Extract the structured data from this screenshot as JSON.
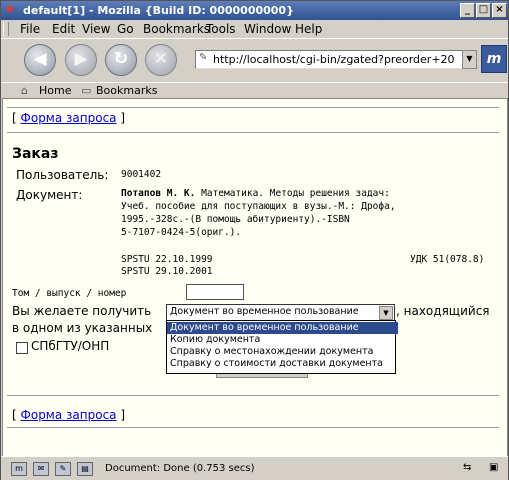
{
  "window": {
    "title": "default[1] - Mozilla {Build ID: 0000000000}",
    "app_icon": "mozilla-star-icon",
    "controls": {
      "minimize": "_",
      "maximize": "□",
      "close": "×"
    }
  },
  "menu": [
    "File",
    "Edit",
    "View",
    "Go",
    "Bookmarks",
    "Tools",
    "Window",
    "Help"
  ],
  "navbar": {
    "back_icon": "back-arrow-icon",
    "forward_icon": "forward-arrow-icon",
    "reload_icon": "reload-icon",
    "stop_icon": "stop-icon",
    "url": "http://localhost/cgi-bin/zgated?preorder+20",
    "logo": "m"
  },
  "personal_toolbar": {
    "home": "Home",
    "bookmarks": "Bookmarks"
  },
  "page": {
    "top_link": "Форма запроса",
    "bracket_open": "[",
    "bracket_close": "]",
    "heading": "Заказ",
    "user_label": "Пользователь:",
    "user_value": "9001402",
    "doc_label": "Документ:",
    "doc_author": "Потапов М. К.",
    "doc_line1_rest": "Математика. Методы решения задач:",
    "doc_line2": "Учеб. пособие для поступающих в вузы.-М.: Дрофа,",
    "doc_line3": "1995.-328с.-(В помощь абитуриенту).-ISBN",
    "doc_line4": "5-7107-0424-5(ориг.).",
    "loc1": "SPSTU 22.10.1999",
    "loc2": "SPSTU 29.10.2001",
    "udk": "УДК 51(078.8)",
    "volume_label": "Том / выпуск / номер",
    "want_label": "Вы желаете получить",
    "want_suffix": ", находящийся",
    "in_one_label": "в одном из указанных",
    "library_checkbox_label": "СПбГТУ/ОНП",
    "select_value": "Документ во временное пользование",
    "options": [
      "Документ во временное пользование",
      "Копию документа",
      "Справку о местонахождении документа",
      "Справку о стоимости доставки документа"
    ],
    "selected_option_index": 0,
    "bottom_link": "Форма запроса"
  },
  "status": {
    "text": "Document: Done (0.753 secs)"
  }
}
